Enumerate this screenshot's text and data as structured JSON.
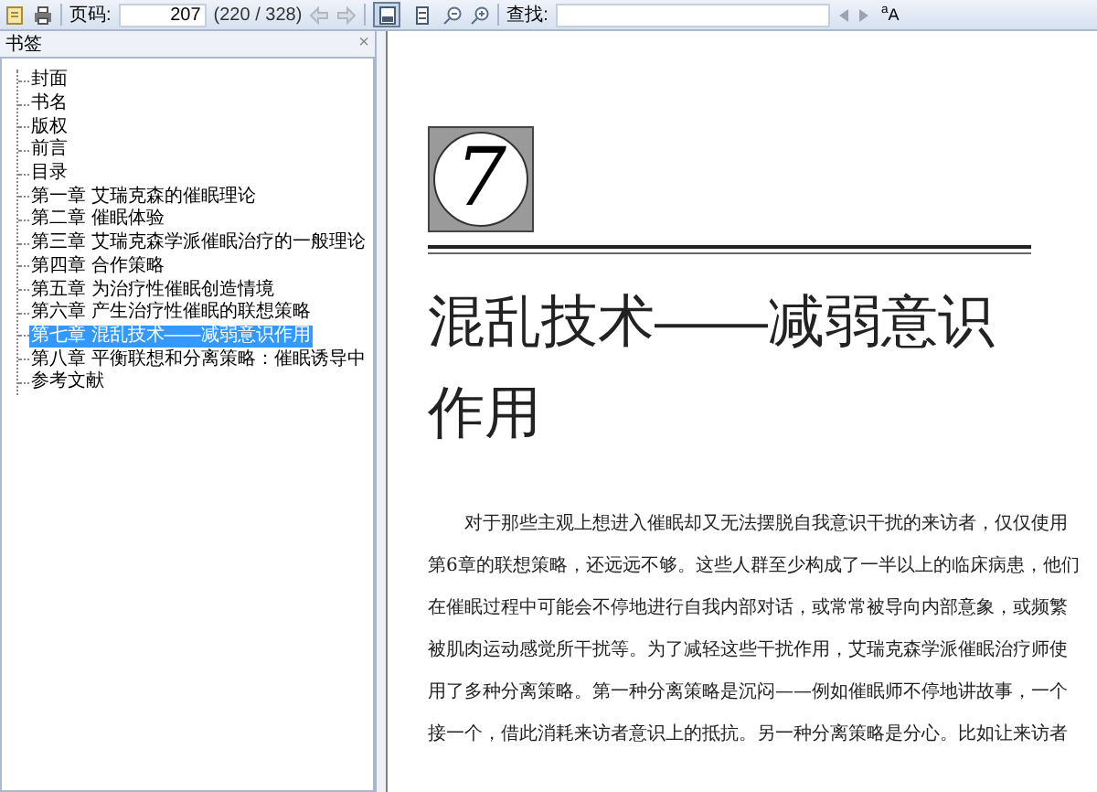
{
  "toolbar": {
    "page_label": "页码:",
    "page_value": "207",
    "page_count": "(220 / 328)",
    "view_modes": [
      {
        "kind": "fit-page",
        "selected": true
      },
      {
        "kind": "fit-width",
        "selected": false
      }
    ],
    "find_label": "查找:",
    "match_case": "$^{a}$A"
  },
  "bookmarks": {
    "title": "书签",
    "close": "×",
    "items": [
      {
        "label": "封面",
        "selected": false
      },
      {
        "label": "书名",
        "selected": false
      },
      {
        "label": "版权",
        "selected": false
      },
      {
        "label": "前言",
        "selected": false
      },
      {
        "label": "目录",
        "selected": false
      },
      {
        "label": "第一章 艾瑞克森的催眠理论",
        "selected": false
      },
      {
        "label": "第二章 催眠体验",
        "selected": false
      },
      {
        "label": "第三章 艾瑞克森学派催眠治疗的一般理论",
        "selected": false
      },
      {
        "label": "第四章 合作策略",
        "selected": false
      },
      {
        "label": "第五章 为治疗性催眠创造情境",
        "selected": false
      },
      {
        "label": "第六章 产生治疗性催眠的联想策略",
        "selected": false
      },
      {
        "label": "第七章 混乱技术——减弱意识作用",
        "selected": true
      },
      {
        "label": "第八章 平衡联想和分离策略：催眠诱导中",
        "selected": false
      },
      {
        "label": "参考文献",
        "selected": false
      }
    ]
  },
  "page": {
    "chapter_number": "7",
    "title_lines": [
      "混乱技术——减弱意识",
      "作用"
    ],
    "body_lines": [
      "对于那些主观上想进入催眠却又无法摆脱自我意识干扰的来访者，仅仅使用",
      "第6章的联想策略，还远远不够。这些人群至少构成了一半以上的临床病患，他们",
      "在催眠过程中可能会不停地进行自我内部对话，或常常被导向内部意象，或频繁",
      "被肌肉运动感觉所干扰等。为了减轻这些干扰作用，艾瑞克森学派催眠治疗师使",
      "用了多种分离策略。第一种分离策略是沉闷——例如催眠师不停地讲故事，一个",
      "接一个，借此消耗来访者意识上的抵抗。另一种分离策略是分心。比如让来访者"
    ]
  }
}
